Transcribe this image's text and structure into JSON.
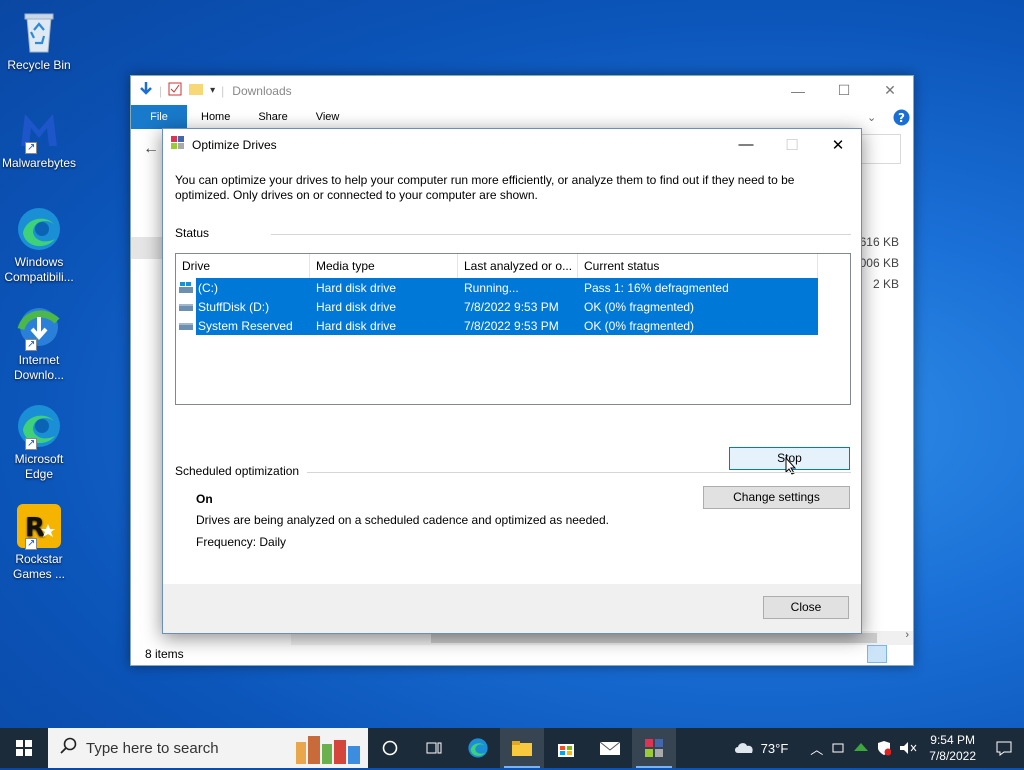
{
  "desktop": {
    "icons": [
      {
        "label": "Recycle Bin"
      },
      {
        "label": "Malwarebytes"
      },
      {
        "label": "Windows Compatibili..."
      },
      {
        "label": "Internet Downlo..."
      },
      {
        "label": "Microsoft Edge"
      },
      {
        "label": "Rockstar Games ..."
      }
    ]
  },
  "explorer": {
    "title": "Downloads",
    "tabs": {
      "file": "File",
      "home": "Home",
      "share": "Share",
      "view": "View"
    },
    "sizes": [
      "616 KB",
      "006 KB",
      "2 KB"
    ],
    "status": "8 items"
  },
  "dialog": {
    "title": "Optimize Drives",
    "description": "You can optimize your drives to help your computer run more efficiently, or analyze them to find out if they need to be optimized. Only drives on or connected to your computer are shown.",
    "status_label": "Status",
    "columns": [
      "Drive",
      "Media type",
      "Last analyzed or o...",
      "Current status"
    ],
    "drives": [
      {
        "name": "(C:)",
        "media": "Hard disk drive",
        "last": "Running...",
        "status": "Pass 1: 16% defragmented"
      },
      {
        "name": "StuffDisk (D:)",
        "media": "Hard disk drive",
        "last": "7/8/2022 9:53 PM",
        "status": "OK (0% fragmented)"
      },
      {
        "name": "System Reserved",
        "media": "Hard disk drive",
        "last": "7/8/2022 9:53 PM",
        "status": "OK (0% fragmented)"
      }
    ],
    "stop_label": "Stop",
    "scheduled_label": "Scheduled optimization",
    "schedule_state": "On",
    "schedule_desc": "Drives are being analyzed on a scheduled cadence and optimized as needed.",
    "frequency": "Frequency: Daily",
    "change_label": "Change settings",
    "close_label": "Close"
  },
  "taskbar": {
    "search_placeholder": "Type here to search",
    "weather": "73°F",
    "time": "9:54 PM",
    "date": "7/8/2022"
  }
}
